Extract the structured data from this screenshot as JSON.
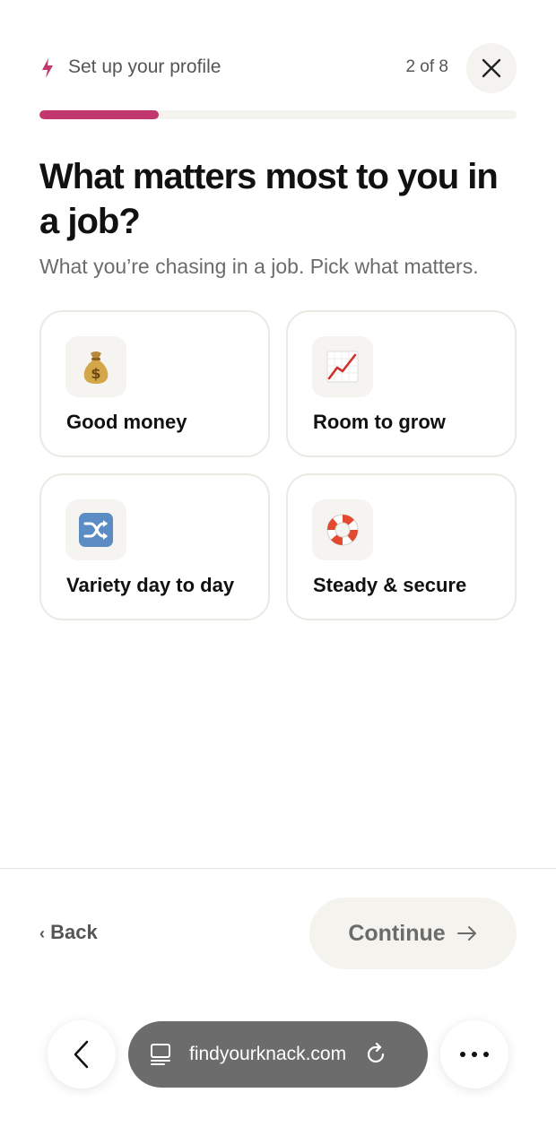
{
  "header": {
    "step_title": "Set up your profile",
    "step_count": "2 of 8",
    "icon": "lightning-bolt-icon",
    "accent_color": "#c0386f"
  },
  "progress": {
    "value": 0.25
  },
  "question": {
    "title": "What matters most to you in a job?",
    "subtitle": "What you’re chasing in a job. Pick what matters."
  },
  "options": [
    {
      "label": "Good money",
      "icon": "money-bag-icon",
      "selected": false
    },
    {
      "label": "Room to grow",
      "icon": "chart-increasing-icon",
      "selected": false
    },
    {
      "label": "Variety day to day",
      "icon": "shuffle-icon",
      "selected": false
    },
    {
      "label": "Steady & secure",
      "icon": "lifebuoy-icon",
      "selected": false
    }
  ],
  "footer": {
    "back_label": "Back",
    "continue_label": "Continue"
  },
  "browser": {
    "url": "findyourknack.com"
  }
}
